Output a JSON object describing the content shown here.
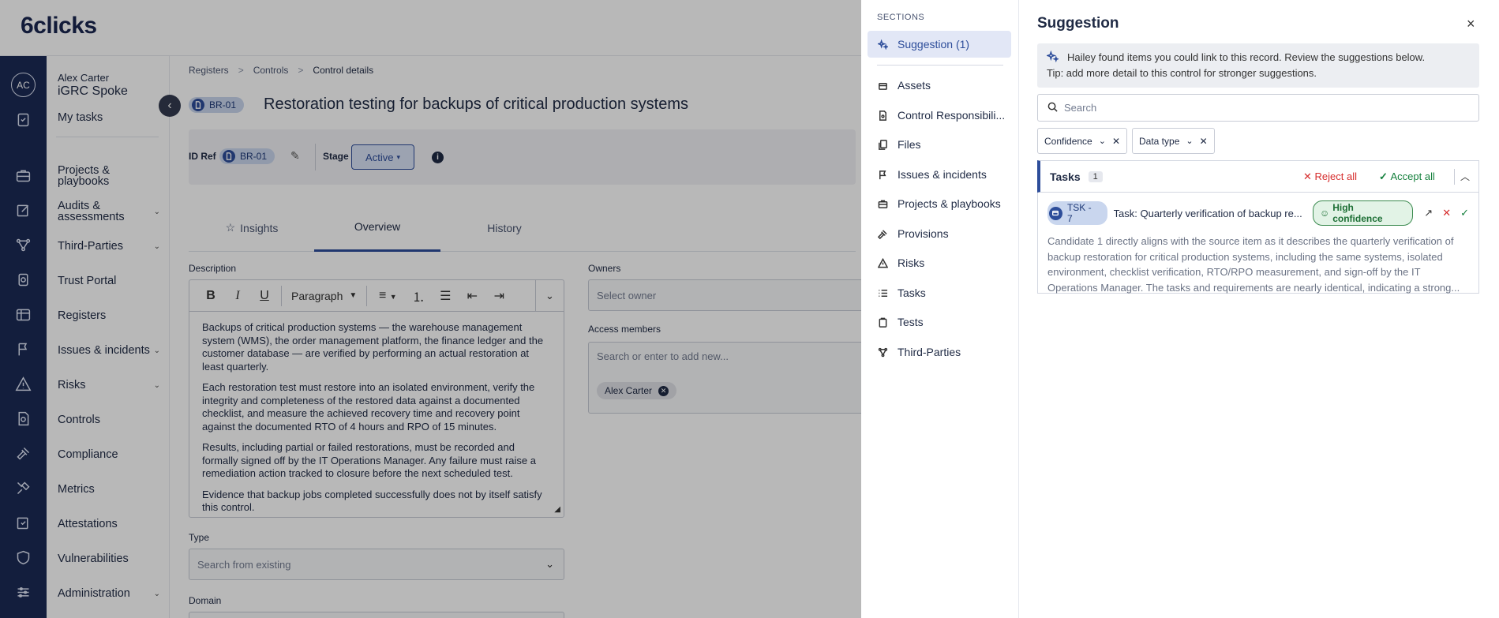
{
  "app": {
    "logo": "6clicks"
  },
  "user": {
    "initials": "AC",
    "name": "Alex Carter",
    "org": "iGRC Spoke"
  },
  "nav": {
    "my_tasks": "My tasks",
    "items": [
      {
        "label": "Projects & playbooks",
        "chev": ""
      },
      {
        "label": "Audits & assessments",
        "chev": "⌄"
      },
      {
        "label": "Third-Parties",
        "chev": "⌄"
      },
      {
        "label": "Trust Portal",
        "chev": ""
      },
      {
        "label": "Registers",
        "chev": ""
      },
      {
        "label": "Issues & incidents",
        "chev": "⌄"
      },
      {
        "label": "Risks",
        "chev": "⌄"
      },
      {
        "label": "Controls",
        "chev": ""
      },
      {
        "label": "Compliance",
        "chev": ""
      },
      {
        "label": "Metrics",
        "chev": ""
      },
      {
        "label": "Attestations",
        "chev": ""
      },
      {
        "label": "Vulnerabilities",
        "chev": ""
      },
      {
        "label": "Administration",
        "chev": "⌄"
      }
    ]
  },
  "breadcrumb": {
    "b1": "Registers",
    "b2": "Controls",
    "b3": "Control details"
  },
  "record": {
    "id": "BR-01",
    "title": "Restoration testing for backups of critical production systems",
    "id_ref_label": "ID Ref",
    "stage_label": "Stage",
    "stage_value": "Active"
  },
  "tabs": {
    "insights": "Insights",
    "overview": "Overview",
    "history": "History"
  },
  "form": {
    "description_label": "Description",
    "paragraph_style": "Paragraph",
    "description": [
      "Backups of critical production systems — the warehouse management system (WMS), the order management platform, the finance ledger and the customer database — are verified by performing an actual restoration at least quarterly.",
      "Each restoration test must restore into an isolated environment, verify the integrity and completeness of the restored data against a documented checklist, and measure the achieved recovery time and recovery point against the documented RTO of 4 hours and RPO of 15 minutes.",
      "Results, including partial or failed restorations, must be recorded and formally signed off by the IT Operations Manager. Any failure must raise a remediation action tracked to closure before the next scheduled test.",
      "Evidence that backup jobs completed successfully does not by itself satisfy this control."
    ],
    "type_label": "Type",
    "type_placeholder": "Search from existing",
    "domain_label": "Domain",
    "owners_label": "Owners",
    "owner_placeholder": "Select owner",
    "access_label": "Access members",
    "access_placeholder": "Search or enter to add new...",
    "member_chip": "Alex Carter"
  },
  "sections": {
    "title": "SECTIONS",
    "items": [
      {
        "label": "Suggestion (1)",
        "icon": "sparkle-icon"
      },
      {
        "label": "Assets",
        "icon": "box-icon"
      },
      {
        "label": "Control Responsibili...",
        "icon": "document-icon"
      },
      {
        "label": "Files",
        "icon": "files-icon"
      },
      {
        "label": "Issues & incidents",
        "icon": "flag-icon"
      },
      {
        "label": "Projects & playbooks",
        "icon": "briefcase-icon"
      },
      {
        "label": "Provisions",
        "icon": "gavel-icon"
      },
      {
        "label": "Risks",
        "icon": "warning-icon"
      },
      {
        "label": "Tasks",
        "icon": "list-icon"
      },
      {
        "label": "Tests",
        "icon": "clipboard-icon"
      },
      {
        "label": "Third-Parties",
        "icon": "network-icon"
      }
    ]
  },
  "suggestion": {
    "title": "Suggestion",
    "banner_line1": "Hailey found items you could link to this record. Review the suggestions below.",
    "banner_line2": "Tip: add more detail to this control for stronger suggestions.",
    "search_placeholder": "Search",
    "filter_confidence": "Confidence",
    "filter_data_type": "Data type",
    "group_title": "Tasks",
    "group_count": "1",
    "reject_all": "Reject all",
    "accept_all": "Accept all",
    "task_id": "TSK - 7",
    "task_title": "Task: Quarterly verification of backup re...",
    "confidence": "High confidence",
    "candidate_text": "Candidate 1 directly aligns with the source item as it describes the quarterly verification of backup restoration for critical production systems, including the same systems, isolated environment, checklist verification, RTO/RPO measurement, and sign-off by the IT Operations Manager. The tasks and requirements are nearly identical, indicating a strong..."
  },
  "colors": {
    "rail": "#1b2a55",
    "accent": "#2d4d9a",
    "reject": "#d62d2d",
    "accept": "#15803d"
  }
}
